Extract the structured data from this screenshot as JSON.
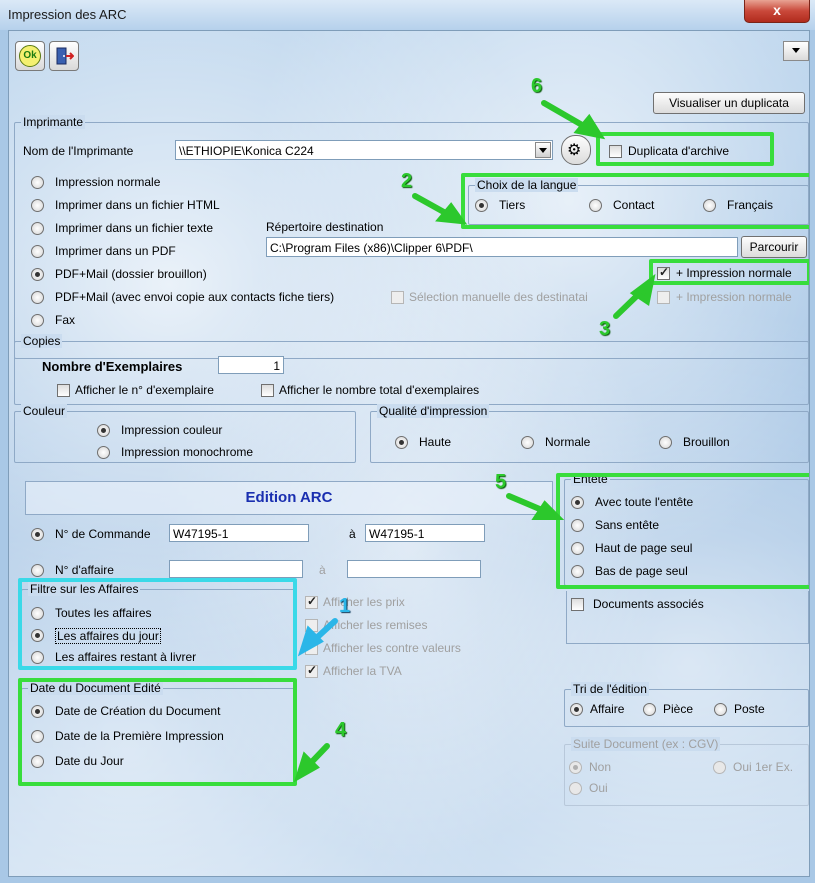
{
  "window": {
    "title": "Impression des ARC",
    "close_label": "x"
  },
  "toolbar": {
    "ok_label": "Ok"
  },
  "duplicata_button": "Visualiser un duplicata",
  "imprimante": {
    "legend": "Imprimante",
    "printer_label": "Nom de l'Imprimante",
    "printer_value": "\\\\ETHIOPIE\\Konica C224",
    "duplicata_archive": "Duplicata d'archive",
    "outputs": [
      "Impression normale",
      "Imprimer dans un fichier HTML",
      "Imprimer dans un fichier texte",
      "Imprimer dans un PDF",
      "PDF+Mail (dossier brouillon)",
      "PDF+Mail (avec envoi copie aux contacts fiche tiers)",
      "Fax"
    ],
    "repertoire_label": "Répertoire destination",
    "repertoire_value": "C:\\Program Files (x86)\\Clipper 6\\PDF\\",
    "parcourir": "Parcourir",
    "selection_manuelle": "Sélection manuelle des destinatai",
    "impression_normale_1": "+ Impression normale",
    "impression_normale_2": "+ Impression normale"
  },
  "langue": {
    "legend": "Choix de la langue",
    "options": [
      "Tiers",
      "Contact",
      "Français"
    ]
  },
  "copies": {
    "legend": "Copies",
    "nombre_label": "Nombre d'Exemplaires",
    "nombre_value": "1",
    "afficher_numero": "Afficher le n° d'exemplaire",
    "afficher_total": "Afficher le nombre total d'exemplaires"
  },
  "couleur": {
    "legend": "Couleur",
    "options": [
      "Impression couleur",
      "Impression monochrome"
    ]
  },
  "qualite": {
    "legend": "Qualité d'impression",
    "options": [
      "Haute",
      "Normale",
      "Brouillon"
    ]
  },
  "edition": {
    "title": "Edition ARC",
    "commande_label": "N° de Commande",
    "commande_from": "W47195-1",
    "a_label": "à",
    "commande_to": "W47195-1",
    "affaire_label": "N° d'affaire",
    "a_label2": "à"
  },
  "entete": {
    "legend": "Entête",
    "options": [
      "Avec toute l'entête",
      "Sans entête",
      "Haut de page seul",
      "Bas de page seul"
    ],
    "documents_associes": "Documents associés"
  },
  "filtre": {
    "legend": "Filtre sur les Affaires",
    "options": [
      "Toutes les affaires",
      "Les affaires du jour",
      "Les affaires restant à livrer"
    ]
  },
  "afficher": [
    "Afficher les prix",
    "Afficher les remises",
    "Afficher les contre valeurs",
    "Afficher la TVA"
  ],
  "date_doc": {
    "legend": "Date du Document Edité",
    "options": [
      "Date de Création du Document",
      "Date de la Première Impression",
      "Date du Jour"
    ]
  },
  "tri": {
    "legend": "Tri de l'édition",
    "options": [
      "Affaire",
      "Pièce",
      "Poste"
    ]
  },
  "suite": {
    "legend": "Suite Document (ex : CGV)",
    "options": [
      "Non",
      "Oui 1er Ex.",
      "Oui"
    ]
  },
  "annotations": [
    "1",
    "2",
    "3",
    "4",
    "5",
    "6"
  ],
  "colors": {
    "highlight_green": "#38dd3c",
    "highlight_cyan": "#3ad9e8",
    "title_blue": "#1a2fb0"
  }
}
